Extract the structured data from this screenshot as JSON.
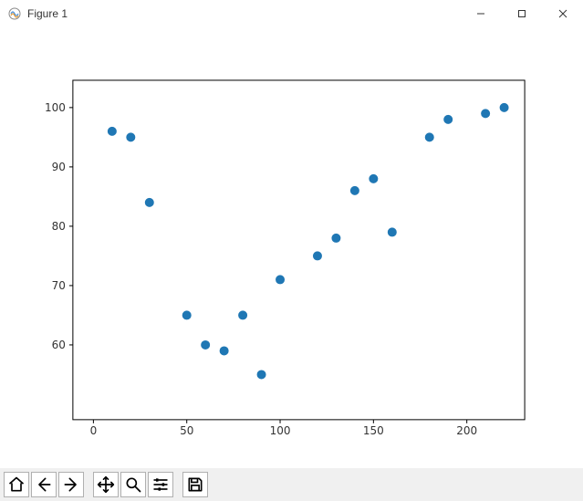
{
  "window": {
    "title": "Figure 1"
  },
  "toolbar": {
    "buttons": [
      {
        "name": "home"
      },
      {
        "name": "back"
      },
      {
        "name": "forward"
      },
      {
        "name": "pan"
      },
      {
        "name": "zoom"
      },
      {
        "name": "configure"
      },
      {
        "name": "save"
      }
    ]
  },
  "chart_data": {
    "type": "scatter",
    "title": "",
    "xlabel": "",
    "ylabel": "",
    "xlim": [
      0,
      220
    ],
    "ylim": [
      50,
      102
    ],
    "x_ticks": [
      0,
      50,
      100,
      150,
      200
    ],
    "y_ticks": [
      60,
      70,
      80,
      90,
      100
    ],
    "marker_color": "#1f77b4",
    "points": [
      {
        "x": 10,
        "y": 96
      },
      {
        "x": 20,
        "y": 95
      },
      {
        "x": 30,
        "y": 84
      },
      {
        "x": 50,
        "y": 65
      },
      {
        "x": 60,
        "y": 60
      },
      {
        "x": 70,
        "y": 59
      },
      {
        "x": 80,
        "y": 65
      },
      {
        "x": 90,
        "y": 55
      },
      {
        "x": 100,
        "y": 71
      },
      {
        "x": 120,
        "y": 75
      },
      {
        "x": 130,
        "y": 78
      },
      {
        "x": 140,
        "y": 86
      },
      {
        "x": 150,
        "y": 88
      },
      {
        "x": 160,
        "y": 79
      },
      {
        "x": 180,
        "y": 95
      },
      {
        "x": 190,
        "y": 98
      },
      {
        "x": 210,
        "y": 99
      },
      {
        "x": 220,
        "y": 100
      }
    ]
  }
}
